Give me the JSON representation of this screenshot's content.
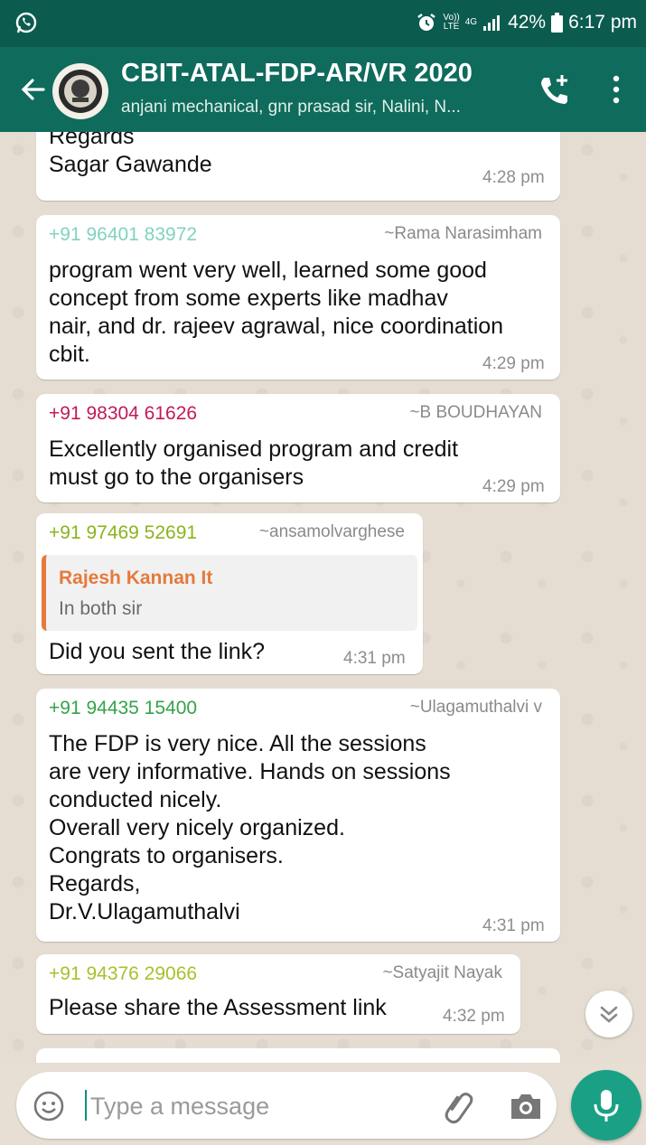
{
  "status_bar": {
    "network_top": "Vo))",
    "network_bottom": "LTE",
    "data_type": "4G",
    "battery": "42%",
    "time": "6:17 pm"
  },
  "header": {
    "title": "CBIT-ATAL-FDP-AR/VR 2020",
    "subtitle": "anjani mechanical, gnr prasad sir, Nalini, N..."
  },
  "messages": [
    {
      "text": "Regards\nSagar Gawande",
      "time": "4:28 pm"
    },
    {
      "phone": "+91 96401 83972",
      "phone_color": "#7fd3bf",
      "alias": "~Rama Narasimham",
      "text": "program went very well, learned some good\nconcept from some experts like madhav\nnair, and dr. rajeev agrawal, nice coordination\ncbit.",
      "time": "4:29 pm"
    },
    {
      "phone": "+91 98304 61626",
      "phone_color": "#c2185b",
      "alias": "~B BOUDHAYAN",
      "text": "Excellently organised program and credit\nmust go to the organisers",
      "time": "4:29 pm"
    },
    {
      "phone": "+91 97469 52691",
      "phone_color": "#8bb31c",
      "alias": "~ansamolvarghese",
      "quote": {
        "name": "Rajesh Kannan It",
        "text": "In both sir"
      },
      "text": "Did you sent the link?",
      "time": "4:31 pm"
    },
    {
      "phone": "+91 94435 15400",
      "phone_color": "#33a34a",
      "alias": "~Ulagamuthalvi v",
      "text": "The FDP is very nice. All the sessions\nare very informative. Hands on sessions\nconducted nicely.\nOverall very nicely organized.\nCongrats to organisers.\nRegards,\nDr.V.Ulagamuthalvi",
      "time": "4:31 pm"
    },
    {
      "phone": "+91 94376 29066",
      "phone_color": "#a9bf2b",
      "alias": "~Satyajit Nayak",
      "text": "Please share the Assessment link",
      "time": "4:32 pm"
    }
  ],
  "composer": {
    "placeholder": "Type a message"
  },
  "icons": {
    "status_app": "whatsapp-icon",
    "alarm": "alarm-icon",
    "back": "back-arrow-icon",
    "call": "add-call-icon",
    "menu": "more-vert-icon",
    "scroll": "chevron-double-down-icon",
    "emoji": "emoji-icon",
    "attach": "paperclip-icon",
    "camera": "camera-icon",
    "mic": "mic-icon"
  },
  "colors": {
    "header": "#0f6b5c",
    "status_bar": "#0b5b4e",
    "accent": "#1aa185",
    "quote_accent": "#e57a3c"
  }
}
